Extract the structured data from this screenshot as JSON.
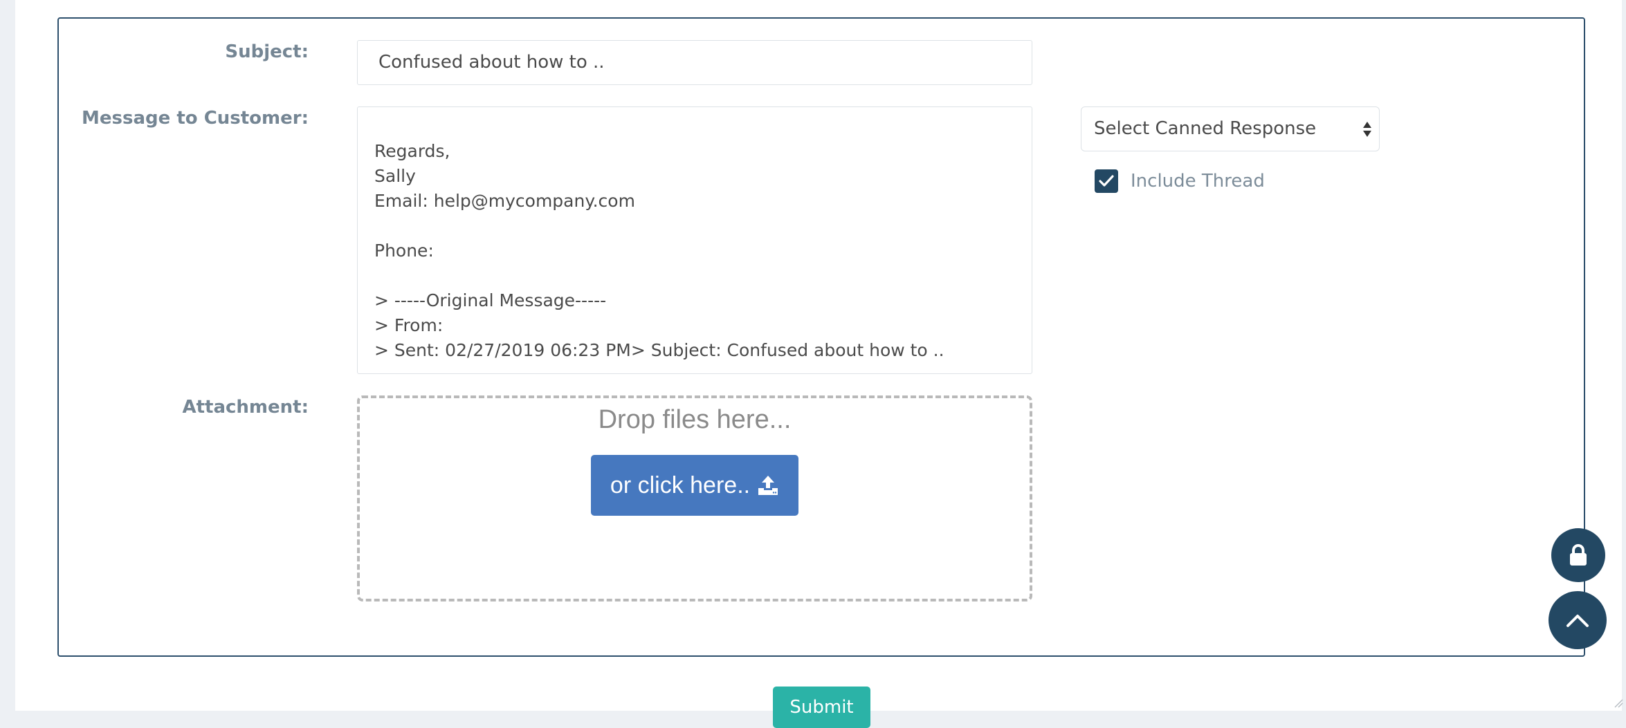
{
  "form": {
    "subject_label": "Subject:",
    "subject_value": "Confused about how to ..",
    "message_label": "Message to Customer:",
    "message_value": "Regards,\nSally\nEmail: help@mycompany.com\n\nPhone:\n\n> -----Original Message-----\n> From:\n> Sent: 02/27/2019 06:23 PM> Subject: Confused about how to ..",
    "canned_response": {
      "selected": "Select Canned Response"
    },
    "include_thread": {
      "label": "Include Thread",
      "checked": true
    },
    "attachment_label": "Attachment:",
    "dropzone": {
      "drop_text": "Drop files here...",
      "click_label": "or click here.."
    },
    "submit_label": "Submit"
  },
  "floating": {
    "lock_icon": "lock-icon",
    "top_icon": "chevron-up-icon"
  },
  "colors": {
    "primary_dark": "#234863",
    "panel_border": "#2d4f6c",
    "upload_button": "#4678bf",
    "submit": "#2bb3a7",
    "label": "#758694"
  }
}
